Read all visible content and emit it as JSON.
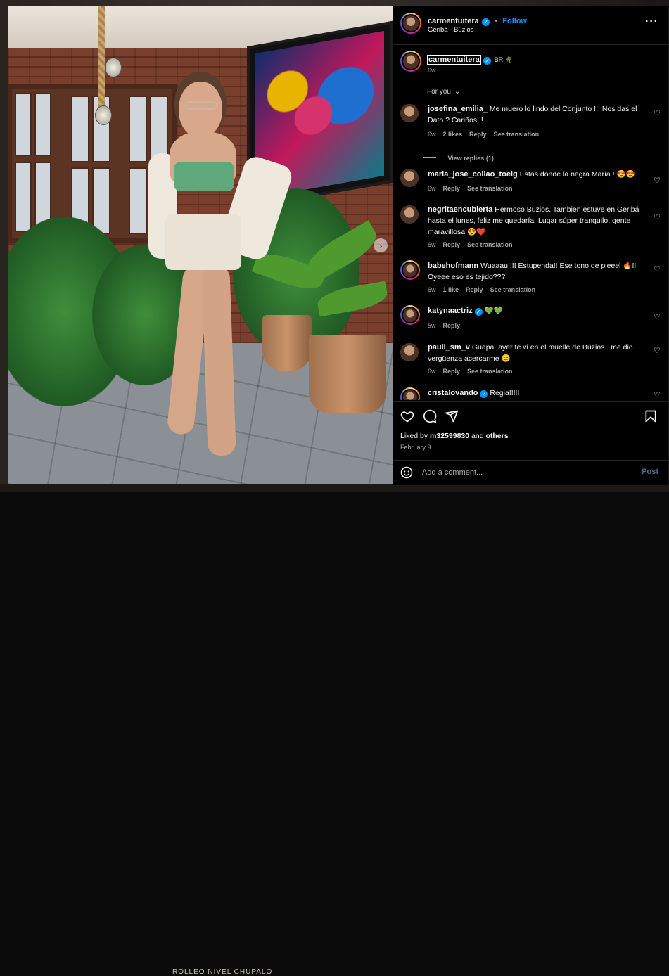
{
  "post": {
    "username": "carmentuitera",
    "follow_label": "Follow",
    "location": "Geribá - Búzios",
    "more_icon": "more-horizontal-icon",
    "caption_suffix": "BR 🌴",
    "caption_time": "6w",
    "media_caption_strip": "ROLLEO NIVEL CHUPALO"
  },
  "comments_filter": "For you",
  "comments": [
    {
      "user": "josefina_emilia_",
      "verified": false,
      "text": "Me muero lo lindo del Conjunto !!! Nos das el Dato ? Cariños !!",
      "time": "6w",
      "likes": "2 likes",
      "reply": "Reply",
      "translate": "See translation"
    },
    {
      "user": "maria_jose_collao_toelg",
      "verified": false,
      "text": "Estás donde la negra María ! 😍😍",
      "time": "6w",
      "likes": "",
      "reply": "Reply",
      "translate": "See translation"
    },
    {
      "user": "negritaencubierta",
      "verified": false,
      "text": "Hermoso Buzios. También estuve en Geribá hasta el lunes, feliz me quedaría. Lugar súper tranquilo, gente maravillosa 😍❤️",
      "time": "6w",
      "likes": "",
      "reply": "Reply",
      "translate": "See translation"
    },
    {
      "user": "babehofmann",
      "verified": false,
      "text": "Wuaaau!!!! Estupenda!! Ese tono de pieeel 🔥!! Oyeee eso es tejido???",
      "time": "6w",
      "likes": "1 like",
      "reply": "Reply",
      "translate": "See translation"
    },
    {
      "user": "katynaactriz",
      "verified": true,
      "text": "💚💚",
      "time": "5w",
      "likes": "",
      "reply": "Reply",
      "translate": ""
    },
    {
      "user": "pauli_sm_v",
      "verified": false,
      "text": "Guapa..ayer te vi en el muelle de Búzios...me dio vergüenza acercarme 😊",
      "time": "6w",
      "likes": "",
      "reply": "Reply",
      "translate": "See translation"
    },
    {
      "user": "cristalovando",
      "verified": true,
      "text": "Regia!!!!!",
      "time": "",
      "likes": "",
      "reply": "",
      "translate": ""
    }
  ],
  "view_replies": "View replies (1)",
  "likes": {
    "prefix": "Liked by",
    "user": "m32599830",
    "and": "and",
    "others": "others"
  },
  "date": "February 9",
  "add_comment": {
    "placeholder": "Add a comment...",
    "post_label": "Post"
  },
  "icons": {
    "like": "heart-icon",
    "comment": "comment-icon",
    "share": "send-icon",
    "save": "bookmark-icon",
    "emoji": "emoji-icon",
    "next": "chevron-right-icon"
  },
  "colors": {
    "accent": "#0095f6",
    "bg": "#000000",
    "muted": "#a8a8a8"
  }
}
